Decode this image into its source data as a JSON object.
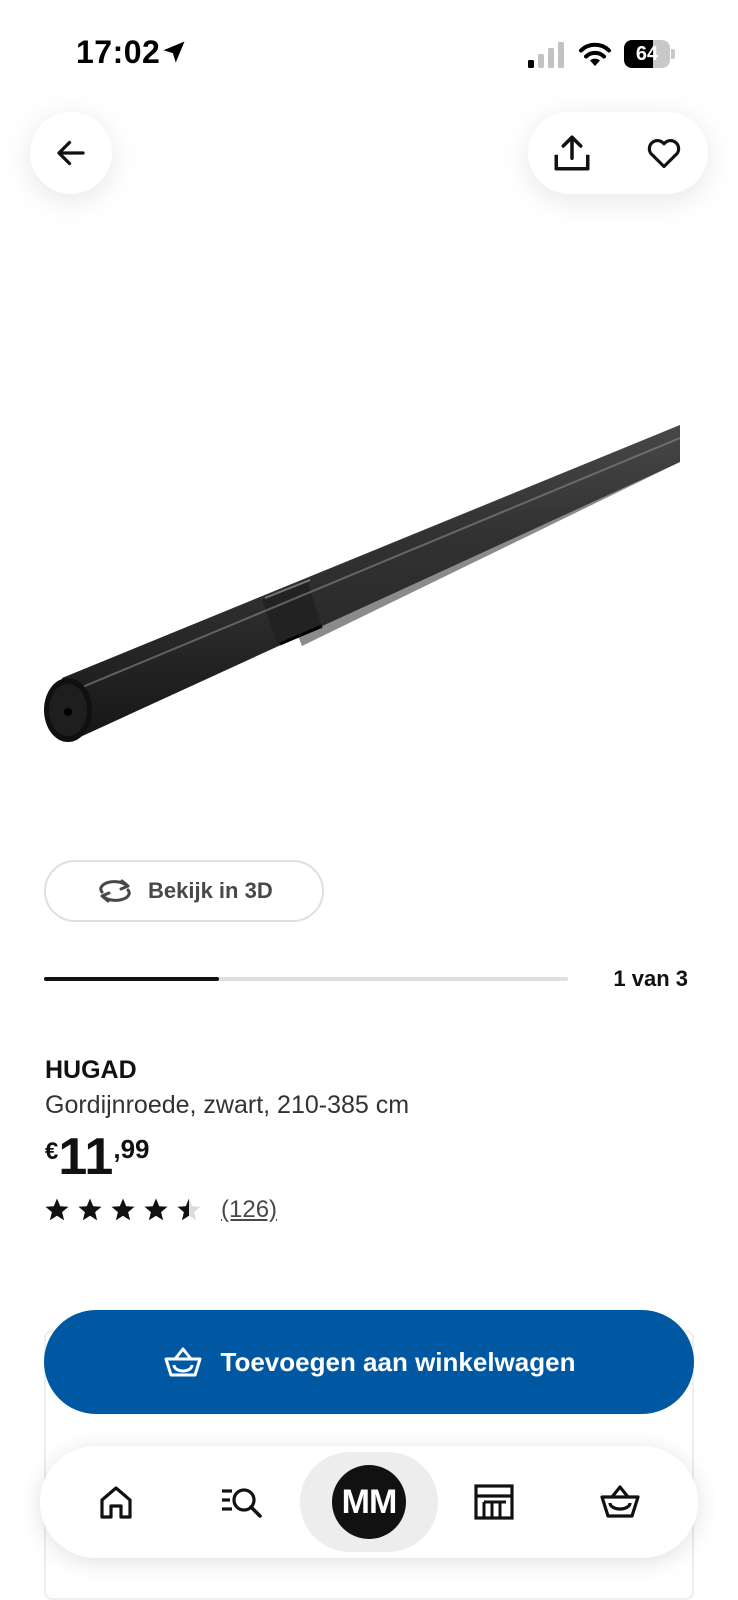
{
  "status_bar": {
    "time": "17:02",
    "battery_level": "64",
    "battery_fraction": 0.64,
    "icons": [
      "location-arrow-icon",
      "cellular-signal-icon",
      "wifi-icon",
      "battery-icon"
    ]
  },
  "header": {
    "back_icon": "arrow-left-icon",
    "share_icon": "share-icon",
    "favorite_icon": "heart-icon"
  },
  "gallery": {
    "view_3d_label": "Bekijk in 3D",
    "counter": "1 van 3",
    "current": 1,
    "total": 3
  },
  "product": {
    "name": "HUGAD",
    "description": "Gordijnroede, zwart, 210-385 cm",
    "price": {
      "currency": "€",
      "integer": "11",
      "decimal": ",99"
    },
    "rating": {
      "stars": 4.5,
      "max": 5,
      "review_count": "(126)"
    }
  },
  "cart": {
    "add_label": "Toevoegen aan winkelwagen",
    "button_color": "#0058a3"
  },
  "bottom_nav": {
    "profile_initials": "MM",
    "items": [
      "home-icon",
      "search-icon",
      "profile-avatar",
      "store-icon",
      "basket-icon"
    ]
  }
}
